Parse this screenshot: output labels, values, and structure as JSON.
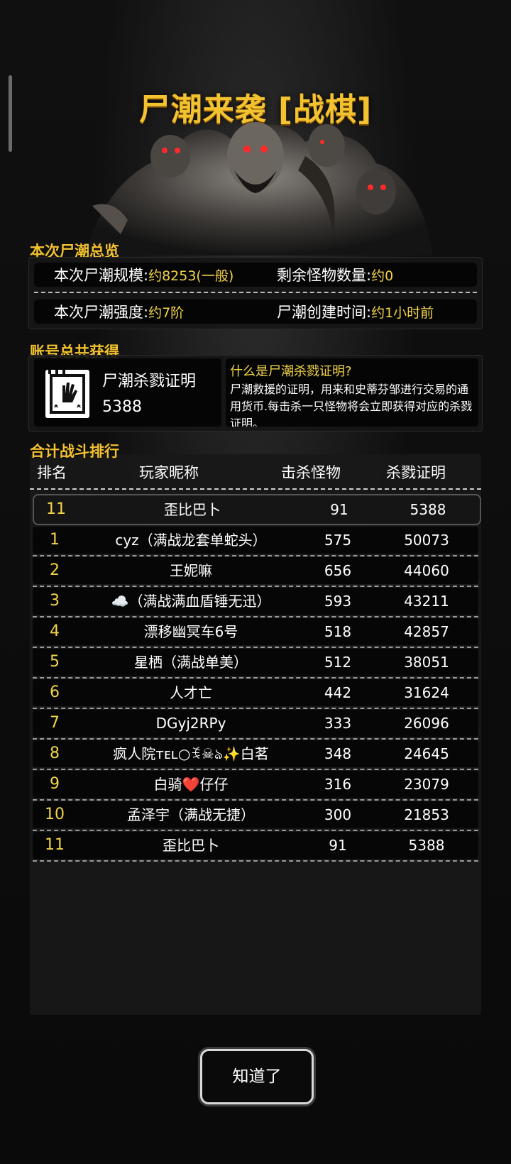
{
  "title": "尸潮来袭 [战棋]",
  "overview": {
    "label": "本次尸潮总览",
    "scale_label": "本次尸潮规模:",
    "scale_value": "约8253(一般)",
    "remaining_label": "剩余怪物数量:",
    "remaining_value": "约0",
    "strength_label": "本次尸潮强度:",
    "strength_value": "约7阶",
    "created_label": "尸潮创建时间:",
    "created_value": "约1小时前"
  },
  "account": {
    "label": "账号总共获得",
    "cert_name": "尸潮杀戮证明",
    "cert_count": "5388",
    "info_title": "什么是尸潮杀戮证明?",
    "info_text": "尸潮救援的证明，用来和史蒂芬邹进行交易的通用货币.每击杀一只怪物将会立即获得对应的杀戮证明。"
  },
  "ranking": {
    "label": "合计战斗排行",
    "headers": {
      "rank": "排名",
      "name": "玩家昵称",
      "kills": "击杀怪物",
      "certs": "杀戮证明"
    },
    "self": {
      "rank": "11",
      "name": "歪比巴卜",
      "kills": "91",
      "certs": "5388"
    },
    "rows": [
      {
        "rank": "1",
        "name": "cyz（满战龙套单蛇头）",
        "kills": "575",
        "certs": "50073"
      },
      {
        "rank": "2",
        "name": "王妮嘛",
        "kills": "656",
        "certs": "44060"
      },
      {
        "rank": "3",
        "name": "☁️（满战满血盾锤无迅）",
        "kills": "593",
        "certs": "43211"
      },
      {
        "rank": "4",
        "name": "漂移幽冥车6号",
        "kills": "518",
        "certs": "42857"
      },
      {
        "rank": "5",
        "name": "星栖（满战单美）",
        "kills": "512",
        "certs": "38051"
      },
      {
        "rank": "6",
        "name": "人才亡",
        "kills": "442",
        "certs": "31624"
      },
      {
        "rank": "7",
        "name": "DGyj2RPy",
        "kills": "333",
        "certs": "26096"
      },
      {
        "rank": "8",
        "name": "疯人院ᴛᴇʟ○ꉂ☠ঌ✨白茗",
        "kills": "348",
        "certs": "24645"
      },
      {
        "rank": "9",
        "name": "白骑❤️仔仔",
        "kills": "316",
        "certs": "23079"
      },
      {
        "rank": "10",
        "name": "孟泽宇（满战无捷）",
        "kills": "300",
        "certs": "21853"
      },
      {
        "rank": "11",
        "name": "歪比巴卜",
        "kills": "91",
        "certs": "5388"
      }
    ]
  },
  "ok_button": "知道了",
  "colors": {
    "accent": "#f2c230",
    "value": "#f2d44a",
    "background": "#0b0b0b"
  }
}
